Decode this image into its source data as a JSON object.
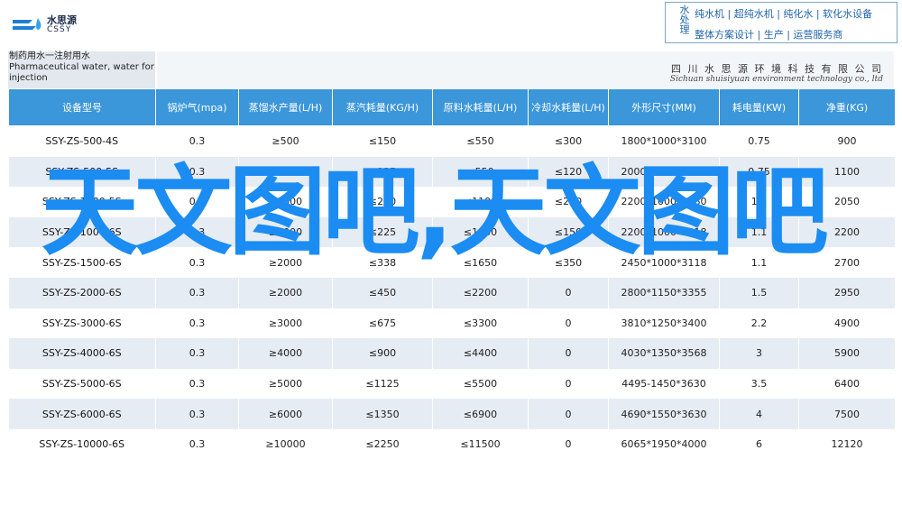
{
  "header": {
    "logo_cn": "水思源",
    "logo_en": "CSSY",
    "brand_vertical_1": "水处理",
    "lines": [
      "纯水机 | 超纯水机 | 纯化水 | 软化水设备",
      "整体方案设计 | 生产 | 运营服务商"
    ]
  },
  "banner": {
    "left_lines": [
      "制药用水一注射用水",
      "Pharmaceutical water, water for",
      "injection"
    ],
    "company_cn": "四 川 水 思 源 环 境 科 技 有 限 公 司",
    "company_en": "Sichuan shuisiyuan environment technology co., ltd"
  },
  "table": {
    "headers": [
      "设备型号",
      "锅炉气(mpa)",
      "蒸馏水产量(L/H)",
      "蒸汽耗量(KG/H)",
      "原料水耗量(L/H)",
      "冷却水耗量(L/H)",
      "外形尺寸(MM)",
      "耗电量(KW)",
      "净重(KG)"
    ],
    "rows": [
      [
        "SSY-ZS-500-4S",
        "0.3",
        "≥500",
        "≤150",
        "≤550",
        "≤300",
        "1800*1000*3100",
        "0.75",
        "900"
      ],
      [
        "SSY-ZS-500-5S",
        "0.3",
        "≥500",
        "≤125",
        "≤550",
        "≤120",
        "2000*1000*3100",
        "0.75",
        "1100"
      ],
      [
        "SSY-ZS-1000-5S",
        "0.3",
        "≥1000",
        "≤250",
        "≤1100",
        "≤240",
        "2200*1000*3380",
        "1.1",
        "2050"
      ],
      [
        "SSY-ZS-1000-6S",
        "0.3",
        "≥1000",
        "≤225",
        "≤1100",
        "≤150",
        "2200*1000*3118",
        "1.1",
        "2200"
      ],
      [
        "SSY-ZS-1500-6S",
        "0.3",
        "≥2000",
        "≤338",
        "≤1650",
        "≤350",
        "2450*1000*3118",
        "1.1",
        "2700"
      ],
      [
        "SSY-ZS-2000-6S",
        "0.3",
        "≥2000",
        "≤450",
        "≤2200",
        "0",
        "2800*1150*3355",
        "1.5",
        "2950"
      ],
      [
        "SSY-ZS-3000-6S",
        "0.3",
        "≥3000",
        "≤675",
        "≤3300",
        "0",
        "3810*1250*3400",
        "2.2",
        "4900"
      ],
      [
        "SSY-ZS-4000-6S",
        "0.3",
        "≥4000",
        "≤900",
        "≤4400",
        "0",
        "4030*1350*3568",
        "3",
        "5900"
      ],
      [
        "SSY-ZS-5000-6S",
        "0.3",
        "≥5000",
        "≤1125",
        "≤5500",
        "0",
        "4495-1450*3630",
        "3.5",
        "6400"
      ],
      [
        "SSY-ZS-6000-6S",
        "0.3",
        "≥6000",
        "≤1350",
        "≤6900",
        "0",
        "4690*1550*3630",
        "4",
        "7500"
      ],
      [
        "SSY-ZS-10000-6S",
        "0.3",
        "≥10000",
        "≤2250",
        "≤11500",
        "0",
        "6065*1950*4000",
        "6",
        "12120"
      ]
    ]
  },
  "watermark": "天文图吧,天文图吧",
  "colors": {
    "header_blue": "#3b96da",
    "watermark_blue": "#1b8cf2",
    "row_alt": "#e6ecf3"
  }
}
